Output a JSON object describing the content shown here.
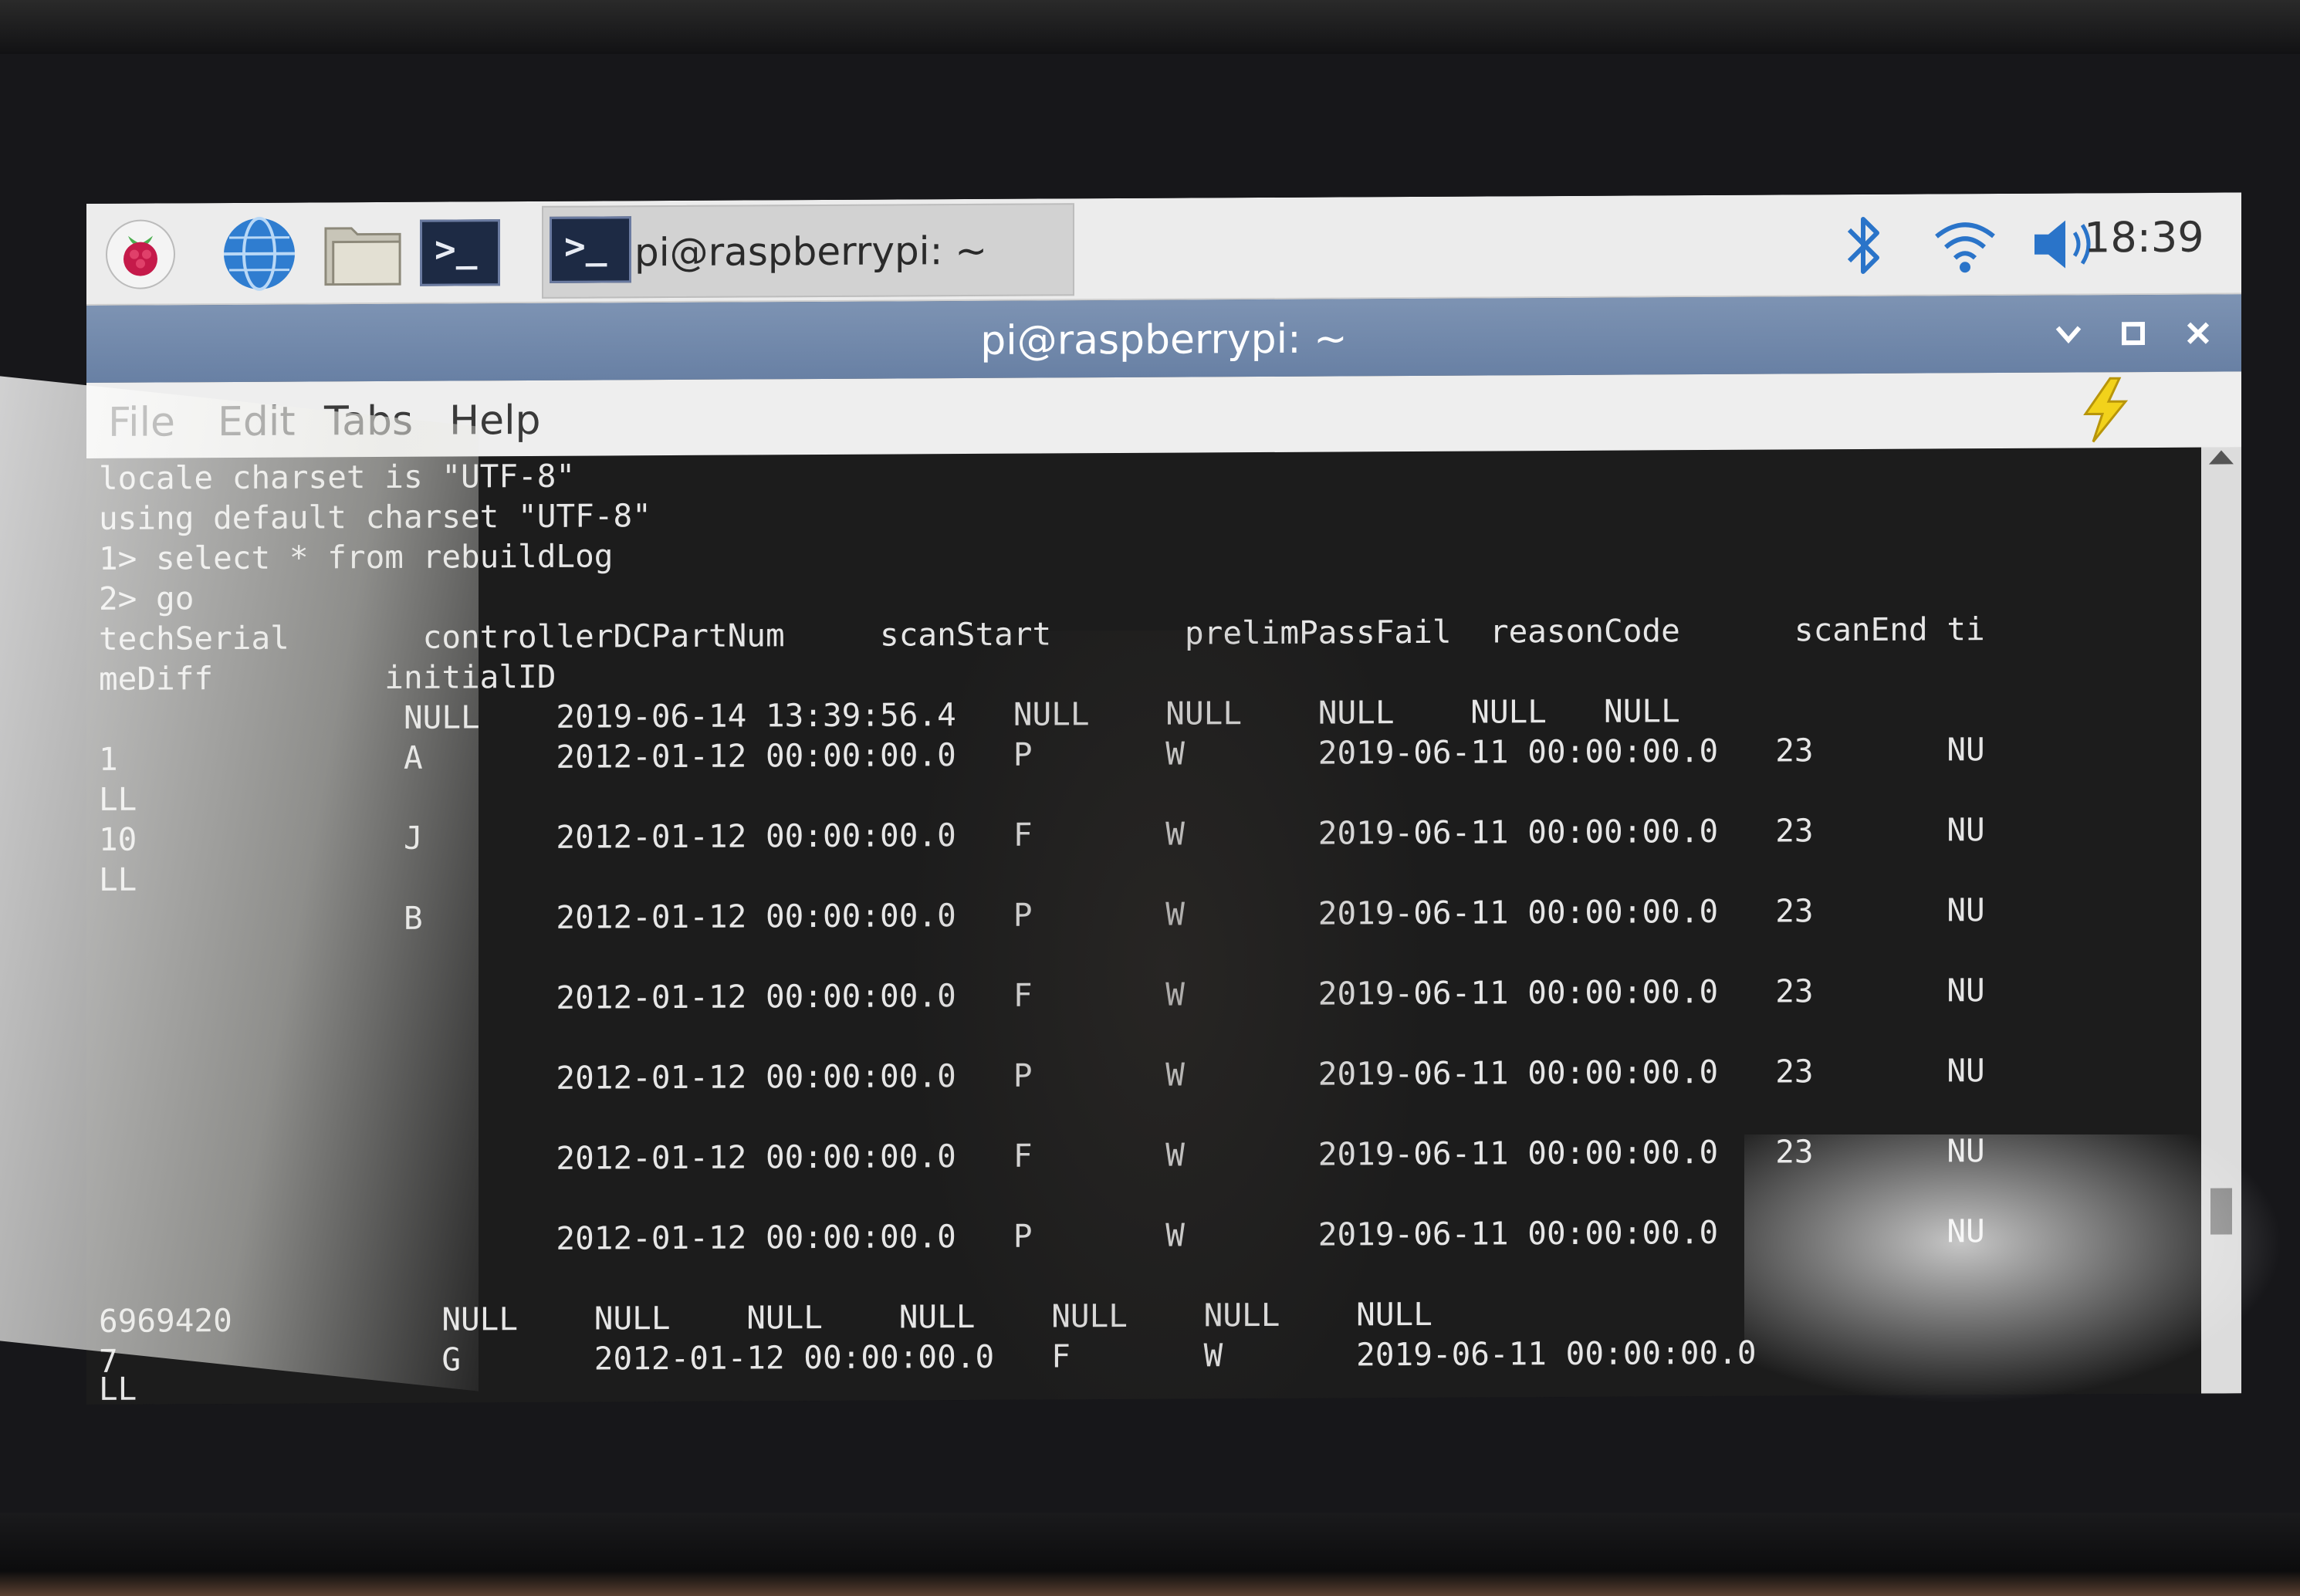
{
  "taskbar": {
    "task_label": "pi@raspberrypi: ~",
    "clock": "18:39",
    "icons": [
      "raspberry-menu-icon",
      "web-browser-icon",
      "file-manager-icon",
      "terminal-icon",
      "bluetooth-icon",
      "wifi-icon",
      "volume-icon"
    ]
  },
  "window": {
    "title": "pi@raspberrypi: ~"
  },
  "menu": {
    "file": "File",
    "edit": "Edit",
    "tabs": "Tabs",
    "help": "Help"
  },
  "terminal": {
    "lines": [
      "locale charset is \"UTF-8\"",
      "using default charset \"UTF-8\"",
      "1> select * from rebuildLog",
      "2> go",
      "techSerial       controllerDCPartNum     scanStart       prelimPassFail  reasonCode      scanEnd ti",
      "meDiff         initialID",
      "                NULL    2019-06-14 13:39:56.4   NULL    NULL    NULL    NULL   NULL",
      "1               A       2012-01-12 00:00:00.0   P       W       2019-06-11 00:00:00.0   23       NU",
      "LL",
      "10              J       2012-01-12 00:00:00.0   F       W       2019-06-11 00:00:00.0   23       NU",
      "LL",
      "                B       2012-01-12 00:00:00.0   P       W       2019-06-11 00:00:00.0   23       NU",
      "",
      "                        2012-01-12 00:00:00.0   F       W       2019-06-11 00:00:00.0   23       NU",
      "",
      "                        2012-01-12 00:00:00.0   P       W       2019-06-11 00:00:00.0   23       NU",
      "",
      "                        2012-01-12 00:00:00.0   F       W       2019-06-11 00:00:00.0   23       NU",
      "",
      "                        2012-01-12 00:00:00.0   P       W       2019-06-11 00:00:00.0            NU",
      "",
      "6969420           NULL    NULL    NULL    NULL    NULL    NULL    NULL",
      "7                 G       2012-01-12 00:00:00.0   F       W       2019-06-11 00:00:00.0",
      "LL"
    ]
  }
}
